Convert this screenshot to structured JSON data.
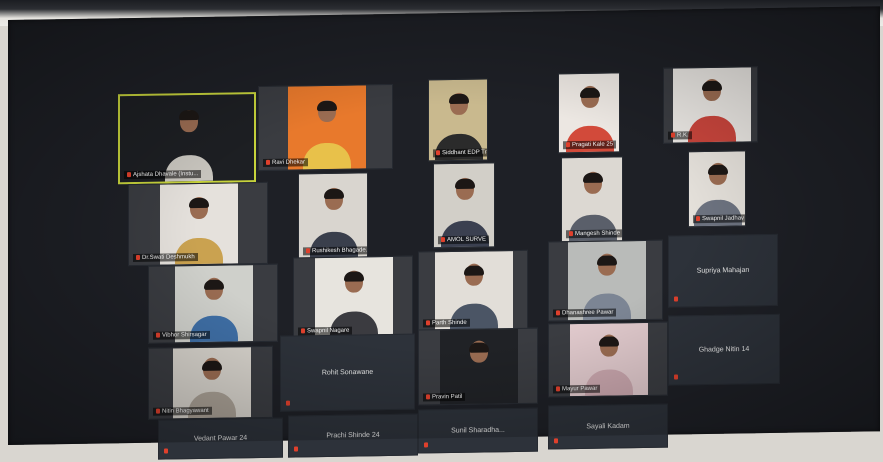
{
  "participants": [
    {
      "name": "Ajshata Dhavale (Instu...",
      "video": true,
      "active": true,
      "shirt": "#c9c6bf"
    },
    {
      "name": "Ravi Dhekar",
      "video": true,
      "bg": "#e8792c",
      "shirt": "#e8c14a"
    },
    {
      "name": "Siddhant EDP Trainin...",
      "video": true,
      "bg": "#c9b98e",
      "shirt": "#2b2b2b"
    },
    {
      "name": "Pragati Kale 25",
      "video": true,
      "bg": "#ece7e2",
      "shirt": "#d24a3a"
    },
    {
      "name": "R.K.",
      "video": true,
      "bg": "#e9e6e2",
      "shirt": "#c8453c"
    },
    {
      "name": "Dr.Swati Deshmukh",
      "video": true,
      "bg": "#e5e1dc",
      "shirt": "#caa250"
    },
    {
      "name": "Rushikesh Bhagade...",
      "video": true,
      "bg": "#d9d5cf",
      "shirt": "#3a3f4c"
    },
    {
      "name": "AMOL SURVE",
      "video": true,
      "bg": "#d2cfc8",
      "shirt": "#3b4050"
    },
    {
      "name": "Mangesh Shinde",
      "video": true,
      "bg": "#dcd8d2",
      "shirt": "#5a5f6a"
    },
    {
      "name": "Swapnil Jadhav",
      "video": true,
      "bg": "#e4e0da",
      "shirt": "#6d7380"
    },
    {
      "name": "Vibhor Shirsagar",
      "video": true,
      "bg": "#cfd0cb",
      "shirt": "#3f6fa6"
    },
    {
      "name": "Swapnil Nagare",
      "video": true,
      "bg": "#e7e4de",
      "shirt": "#3b3b40"
    },
    {
      "name": "Parth Shinde",
      "video": true,
      "bg": "#e2ded8",
      "shirt": "#4b5565"
    },
    {
      "name": "Dhanashree Pawar",
      "video": true,
      "bg": "#b9bbb9",
      "shirt": "#7c8594"
    },
    {
      "name": "Supriya Mahajan",
      "video": false
    },
    {
      "name": "Nitin Bhagyawant",
      "video": true,
      "bg": "#d7d3cc",
      "shirt": "#a9a095"
    },
    {
      "name": "Rohit Sonawane",
      "video": false
    },
    {
      "name": "Pravin Patil",
      "video": true,
      "bg": "#202226",
      "shirt": "#202226"
    },
    {
      "name": "Mayur Pawar",
      "video": true,
      "bg": "#e0c9cc",
      "shirt": "#c9a6ad"
    },
    {
      "name": "Ghadge Nitin 14",
      "video": false
    },
    {
      "name": "Vedant Pawar 24",
      "video": false
    },
    {
      "name": "Prachi Shinde 24",
      "video": false
    },
    {
      "name": "Sunil Sharadha...",
      "video": false
    },
    {
      "name": "Sayali Kadam",
      "video": false
    }
  ]
}
